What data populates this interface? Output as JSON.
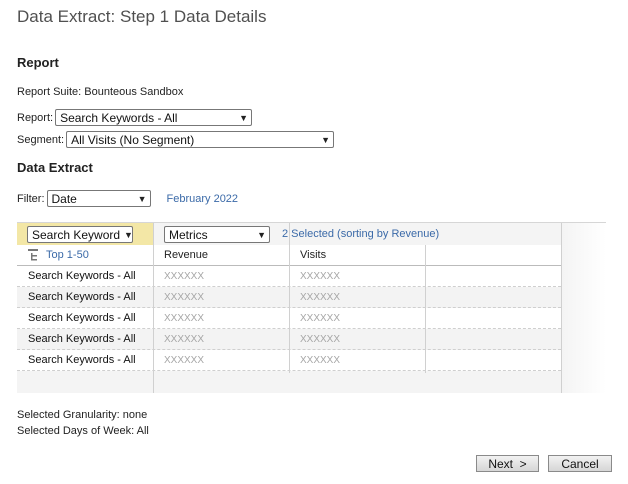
{
  "page": {
    "title": "Data Extract: Step 1 Data Details"
  },
  "report": {
    "heading": "Report",
    "suite_label": "Report Suite: Bounteous Sandbox",
    "report_label": "Report:",
    "report_value": "Search Keywords - All",
    "segment_label": "Segment:",
    "segment_value": "All Visits (No Segment)"
  },
  "extract": {
    "heading": "Data Extract",
    "filter_label": "Filter:",
    "filter_value": "Date",
    "date_link": "February 2022"
  },
  "grid": {
    "dimension_select": "Search Keywords - All",
    "dimension_display": "Search Keyword",
    "metrics_select": "Metrics",
    "selected_text": "2 Selected (sorting by Revenue)",
    "top_link": "Top 1-50",
    "columns": [
      "Revenue",
      "Visits"
    ],
    "rows": [
      {
        "key": "Search Keywords - All",
        "revenue": "XXXXXX",
        "visits": "XXXXXX"
      },
      {
        "key": "Search Keywords - All",
        "revenue": "XXXXXX",
        "visits": "XXXXXX"
      },
      {
        "key": "Search Keywords - All",
        "revenue": "XXXXXX",
        "visits": "XXXXXX"
      },
      {
        "key": "Search Keywords - All",
        "revenue": "XXXXXX",
        "visits": "XXXXXX"
      },
      {
        "key": "Search Keywords - All",
        "revenue": "XXXXXX",
        "visits": "XXXXXX"
      }
    ]
  },
  "summary": {
    "granularity": "Selected Granularity: none",
    "days": "Selected Days of Week: All"
  },
  "buttons": {
    "next": "Next  >",
    "cancel": "Cancel"
  },
  "icons": {
    "chevron": "chevron-down-icon",
    "hierarchy": "hierarchy-icon"
  }
}
